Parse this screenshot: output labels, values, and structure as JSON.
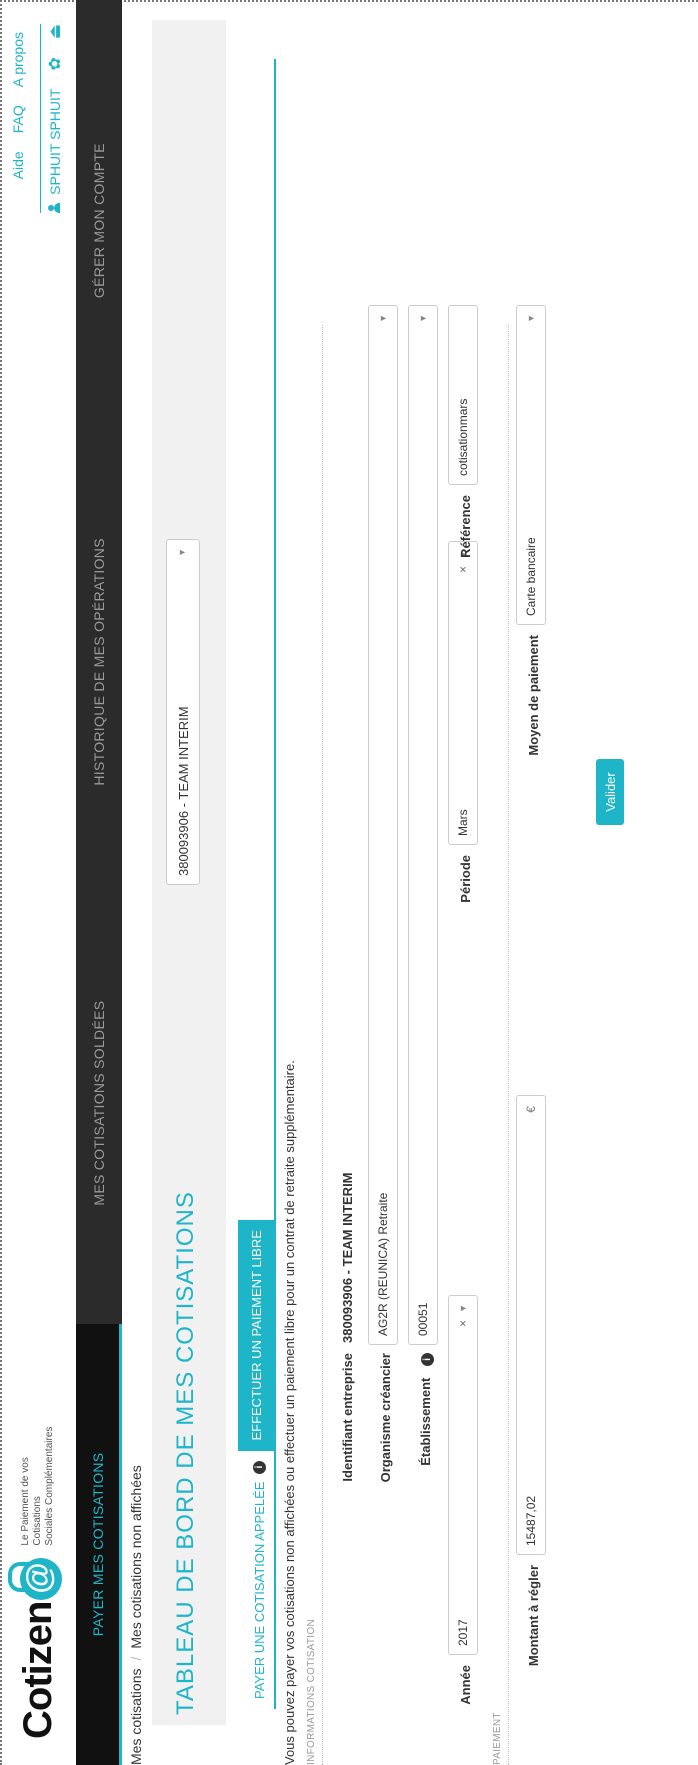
{
  "brand": {
    "name": "Cotizen",
    "tagline_line1": "Le Paiement de vos Cotisations",
    "tagline_line2": "Sociales Complémentaires"
  },
  "header": {
    "links": [
      "Aide",
      "FAQ",
      "A propos"
    ],
    "user_name": "SPHUIT SPHUIT"
  },
  "nav": {
    "items": [
      {
        "label": "PAYER MES COTISATIONS",
        "active": true
      },
      {
        "label": "MES COTISATIONS SOLDÉES",
        "active": false
      },
      {
        "label": "HISTORIQUE DE MES OPÉRATIONS",
        "active": false
      },
      {
        "label": "GÉRER MON COMPTE",
        "active": false
      }
    ]
  },
  "breadcrumb": {
    "root": "Mes cotisations",
    "separator": "/",
    "current": "Mes cotisations non affichées"
  },
  "page": {
    "title": "TABLEAU DE BORD DE MES COTISATIONS",
    "company_selector": "380093906 - TEAM INTERIM"
  },
  "tabs": {
    "called": "PAYER UNE COTISATION APPELÉE",
    "free": "EFFECTUER UN PAIEMENT LIBRE"
  },
  "intro_text": "Vous pouvez payer vos cotisations non affichées ou effectuer un paiement libre pour un contrat de retraite supplémentaire.",
  "sections": {
    "info": "INFORMATIONS COTISATION",
    "payment": "PAIEMENT"
  },
  "form": {
    "company_id_label": "Identifiant entreprise",
    "company_id_value": "380093906 - TEAM INTERIM",
    "creditor_label": "Organisme créancier",
    "creditor_value": "AG2R (REUNICA) Retraite",
    "establishment_label": "Établissement",
    "establishment_value": "00051",
    "year_label": "Année",
    "year_value": "2017",
    "period_label": "Période",
    "period_value": "Mars",
    "reference_label": "Référence",
    "reference_value": "cotisationmars",
    "amount_label": "Montant à régler",
    "amount_value": "15487,02",
    "currency": "€",
    "payment_method_label": "Moyen de paiement",
    "payment_method_value": "Carte bancaire",
    "submit_label": "Valider"
  },
  "colors": {
    "accent": "#1fb5c8",
    "nav_bg": "#2b2b2b",
    "nav_active_bg": "#111111"
  }
}
